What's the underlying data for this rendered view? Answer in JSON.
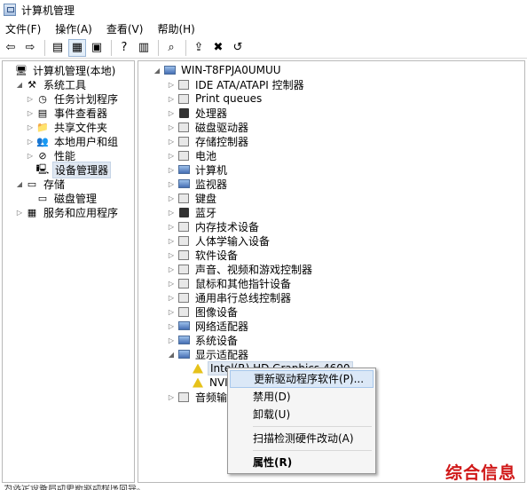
{
  "window": {
    "title": "计算机管理"
  },
  "menubar": [
    "文件(F)",
    "操作(A)",
    "查看(V)",
    "帮助(H)"
  ],
  "toolbar": [
    {
      "icon": "back-arrow-icon",
      "glyph": "⇦"
    },
    {
      "icon": "forward-arrow-icon",
      "glyph": "⇨"
    },
    {
      "sep": true
    },
    {
      "icon": "up-folder-icon",
      "glyph": "▤"
    },
    {
      "icon": "show-hide-tree-icon",
      "glyph": "▦",
      "selected": true
    },
    {
      "icon": "properties-icon",
      "glyph": "▣"
    },
    {
      "sep": true
    },
    {
      "icon": "help-icon",
      "glyph": "?"
    },
    {
      "icon": "view-icon",
      "glyph": "▥"
    },
    {
      "sep": true
    },
    {
      "icon": "scan-hardware-icon",
      "glyph": "⌕"
    },
    {
      "sep": true
    },
    {
      "icon": "update-driver-icon",
      "glyph": "⇪"
    },
    {
      "icon": "disable-device-icon",
      "glyph": "✖"
    },
    {
      "icon": "uninstall-device-icon",
      "glyph": "↺"
    }
  ],
  "left_tree": [
    {
      "label": "计算机管理(本地)",
      "level": 0,
      "exp": "",
      "icon": "computer-management-icon",
      "glyph": "🖥"
    },
    {
      "label": "系统工具",
      "level": 1,
      "exp": "◢",
      "icon": "system-tools-icon",
      "glyph": "⚒"
    },
    {
      "label": "任务计划程序",
      "level": 2,
      "exp": "▷",
      "icon": "task-scheduler-icon",
      "glyph": "◷"
    },
    {
      "label": "事件查看器",
      "level": 2,
      "exp": "▷",
      "icon": "event-viewer-icon",
      "glyph": "▤"
    },
    {
      "label": "共享文件夹",
      "level": 2,
      "exp": "▷",
      "icon": "shared-folders-icon",
      "glyph": "📁"
    },
    {
      "label": "本地用户和组",
      "level": 2,
      "exp": "▷",
      "icon": "local-users-icon",
      "glyph": "👥"
    },
    {
      "label": "性能",
      "level": 2,
      "exp": "▷",
      "icon": "performance-icon",
      "glyph": "⊘"
    },
    {
      "label": "设备管理器",
      "level": 2,
      "exp": "",
      "icon": "device-manager-icon",
      "glyph": "🖳",
      "selected": true
    },
    {
      "label": "存储",
      "level": 1,
      "exp": "◢",
      "icon": "storage-icon",
      "glyph": "▭"
    },
    {
      "label": "磁盘管理",
      "level": 2,
      "exp": "",
      "icon": "disk-management-icon",
      "glyph": "▭"
    },
    {
      "label": "服务和应用程序",
      "level": 1,
      "exp": "▷",
      "icon": "services-apps-icon",
      "glyph": "▦"
    }
  ],
  "right_tree": [
    {
      "label": "WIN-T8FPJA0UMUU",
      "level": 0,
      "exp": "◢",
      "icon": "computer-icon",
      "cls": "ico-monitor"
    },
    {
      "label": "IDE ATA/ATAPI 控制器",
      "level": 1,
      "exp": "▷",
      "icon": "ide-controller-icon",
      "cls": "ico-dev"
    },
    {
      "label": "Print queues",
      "level": 1,
      "exp": "▷",
      "icon": "print-queue-icon",
      "cls": "ico-dev"
    },
    {
      "label": "处理器",
      "level": 1,
      "exp": "▷",
      "icon": "processor-icon",
      "cls": "ico-dark"
    },
    {
      "label": "磁盘驱动器",
      "level": 1,
      "exp": "▷",
      "icon": "disk-drive-icon",
      "cls": "ico-dev"
    },
    {
      "label": "存储控制器",
      "level": 1,
      "exp": "▷",
      "icon": "storage-controller-icon",
      "cls": "ico-dev"
    },
    {
      "label": "电池",
      "level": 1,
      "exp": "▷",
      "icon": "battery-icon",
      "cls": "ico-dev"
    },
    {
      "label": "计算机",
      "level": 1,
      "exp": "▷",
      "icon": "computer-node-icon",
      "cls": "ico-monitor"
    },
    {
      "label": "监视器",
      "level": 1,
      "exp": "▷",
      "icon": "monitor-icon",
      "cls": "ico-monitor"
    },
    {
      "label": "键盘",
      "level": 1,
      "exp": "▷",
      "icon": "keyboard-icon",
      "cls": "ico-dev"
    },
    {
      "label": "蓝牙",
      "level": 1,
      "exp": "▷",
      "icon": "bluetooth-icon",
      "cls": "ico-dark"
    },
    {
      "label": "内存技术设备",
      "level": 1,
      "exp": "▷",
      "icon": "memory-device-icon",
      "cls": "ico-dev"
    },
    {
      "label": "人体学输入设备",
      "level": 1,
      "exp": "▷",
      "icon": "hid-icon",
      "cls": "ico-dev"
    },
    {
      "label": "软件设备",
      "level": 1,
      "exp": "▷",
      "icon": "software-device-icon",
      "cls": "ico-dev"
    },
    {
      "label": "声音、视频和游戏控制器",
      "level": 1,
      "exp": "▷",
      "icon": "sound-icon",
      "cls": "ico-dev"
    },
    {
      "label": "鼠标和其他指针设备",
      "level": 1,
      "exp": "▷",
      "icon": "mouse-icon",
      "cls": "ico-dev"
    },
    {
      "label": "通用串行总线控制器",
      "level": 1,
      "exp": "▷",
      "icon": "usb-icon",
      "cls": "ico-dev"
    },
    {
      "label": "图像设备",
      "level": 1,
      "exp": "▷",
      "icon": "imaging-device-icon",
      "cls": "ico-dev"
    },
    {
      "label": "网络适配器",
      "level": 1,
      "exp": "▷",
      "icon": "network-adapter-icon",
      "cls": "ico-monitor"
    },
    {
      "label": "系统设备",
      "level": 1,
      "exp": "▷",
      "icon": "system-device-icon",
      "cls": "ico-monitor"
    },
    {
      "label": "显示适配器",
      "level": 1,
      "exp": "◢",
      "icon": "display-adapter-icon",
      "cls": "ico-monitor"
    },
    {
      "label": "Intel(R) HD Graphics 4600",
      "level": 2,
      "exp": "",
      "icon": "warning-device-icon",
      "cls": "ico-warn",
      "selected": true
    },
    {
      "label": "NVIDIA",
      "level": 2,
      "exp": "",
      "icon": "warning-device-icon",
      "cls": "ico-warn"
    },
    {
      "label": "音频输入和输出",
      "level": 1,
      "exp": "▷",
      "icon": "audio-io-icon",
      "cls": "ico-dev"
    }
  ],
  "context_menu": [
    {
      "label": "更新驱动程序软件(P)...",
      "highlight": true
    },
    {
      "label": "禁用(D)"
    },
    {
      "label": "卸载(U)"
    },
    {
      "sep": true
    },
    {
      "label": "扫描检测硬件改动(A)"
    },
    {
      "sep": true
    },
    {
      "label": "属性(R)",
      "bold": true
    }
  ],
  "statusbar": {
    "text": "为选定设备启动更新驱动程序向导。"
  },
  "watermark": {
    "text": "综合信息"
  },
  "colors": {
    "watermark": "#d01818",
    "selection": "#dfe7f1",
    "menu_highlight": "#dbe8f7"
  }
}
